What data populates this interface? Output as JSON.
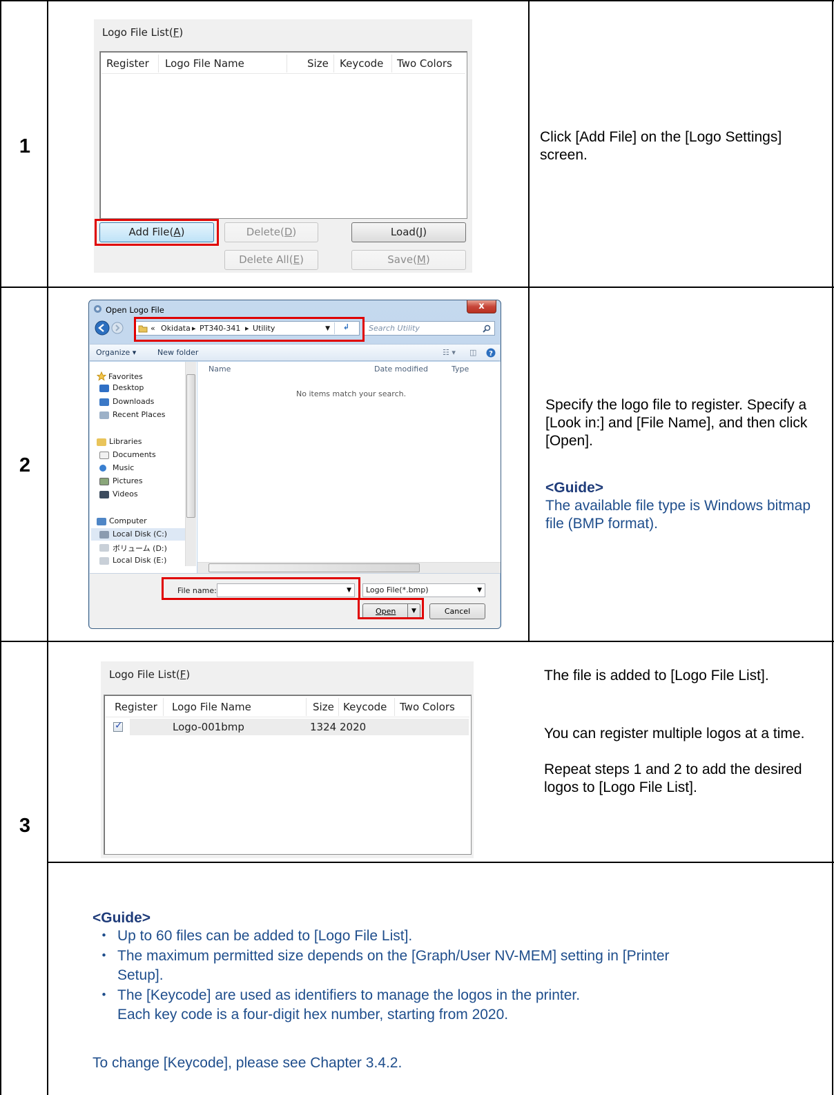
{
  "steps": [
    {
      "number": "1",
      "description": "Click [Add File] on the [Logo Settings] screen."
    },
    {
      "number": "2",
      "description": "Specify the logo file to register. Specify a [Look in:] and [File Name], and then click [Open].",
      "guide_title": "<Guide>",
      "guide_text": "The available file type is Windows bitmap file (BMP format)."
    },
    {
      "number": "3",
      "description_1": "The file is added to [Logo File List].",
      "description_2": "You can register multiple logos at a time.",
      "description_3": "Repeat steps 1 and 2 to add the desired logos to [Logo File List]."
    }
  ],
  "logo_panel": {
    "caption_text": "Logo File List(",
    "caption_key": "F",
    "columns": [
      "Register",
      "Logo File Name",
      "Size",
      "Keycode",
      "Two Colors"
    ],
    "buttons": {
      "add_text": "Add File(",
      "add_key": "A",
      "delete_text": "Delete(",
      "delete_key": "D",
      "load_text": "Load(",
      "load_key": "J",
      "delete_all_text": "Delete All(",
      "delete_all_key": "E",
      "save_text": "Save(",
      "save_key": "M",
      "close_paren": ")"
    }
  },
  "logo_panel_after": {
    "row": {
      "registered": true,
      "file_name": "Logo-001bmp",
      "size": "1324",
      "keycode": "2020",
      "two_colors": ""
    }
  },
  "open_dialog": {
    "title": "Open Logo File",
    "close_label": "x",
    "breadcrumb": [
      "«",
      "Okidata",
      "PT340-341",
      "Utility"
    ],
    "breadcrumb_sep": "▸",
    "search_placeholder": "Search Utility",
    "toolbar": {
      "organize": "Organize ▾",
      "new_folder": "New folder"
    },
    "nav_items": [
      {
        "label": "Favorites",
        "icon": "star-icon"
      },
      {
        "label": "Desktop",
        "icon": "desktop-icon"
      },
      {
        "label": "Downloads",
        "icon": "downloads-icon"
      },
      {
        "label": "Recent Places",
        "icon": "recent-places-icon"
      },
      {
        "label": "Libraries",
        "icon": "libraries-icon"
      },
      {
        "label": "Documents",
        "icon": "documents-icon"
      },
      {
        "label": "Music",
        "icon": "music-icon"
      },
      {
        "label": "Pictures",
        "icon": "pictures-icon"
      },
      {
        "label": "Videos",
        "icon": "videos-icon"
      },
      {
        "label": "Computer",
        "icon": "computer-icon"
      },
      {
        "label": "Local Disk (C:)",
        "icon": "disk-icon"
      },
      {
        "label": "ボリューム (D:)",
        "icon": "disk-icon"
      },
      {
        "label": "Local Disk (E:)",
        "icon": "disk-icon"
      }
    ],
    "columns": {
      "name": "Name",
      "date_modified": "Date modified",
      "type": "Type"
    },
    "empty_message": "No items match your search.",
    "file_name_label": "File name:",
    "file_name_value": "",
    "file_type": "Logo File(*.bmp)",
    "open_label": "Open",
    "cancel_label": "Cancel"
  },
  "guide_block": {
    "title": "<Guide>",
    "bullet": "・",
    "items": [
      "Up to 60 files can be added to [Logo File List].",
      "The maximum permitted size depends on the [Graph/User NV-MEM] setting in [Printer",
      "Setup].",
      "The [Keycode] are used as identifiers to manage the logos in the printer.",
      "Each key code is a four-digit hex number, starting from 2020."
    ],
    "footer": "To change [Keycode], please see Chapter 3.4.2."
  }
}
